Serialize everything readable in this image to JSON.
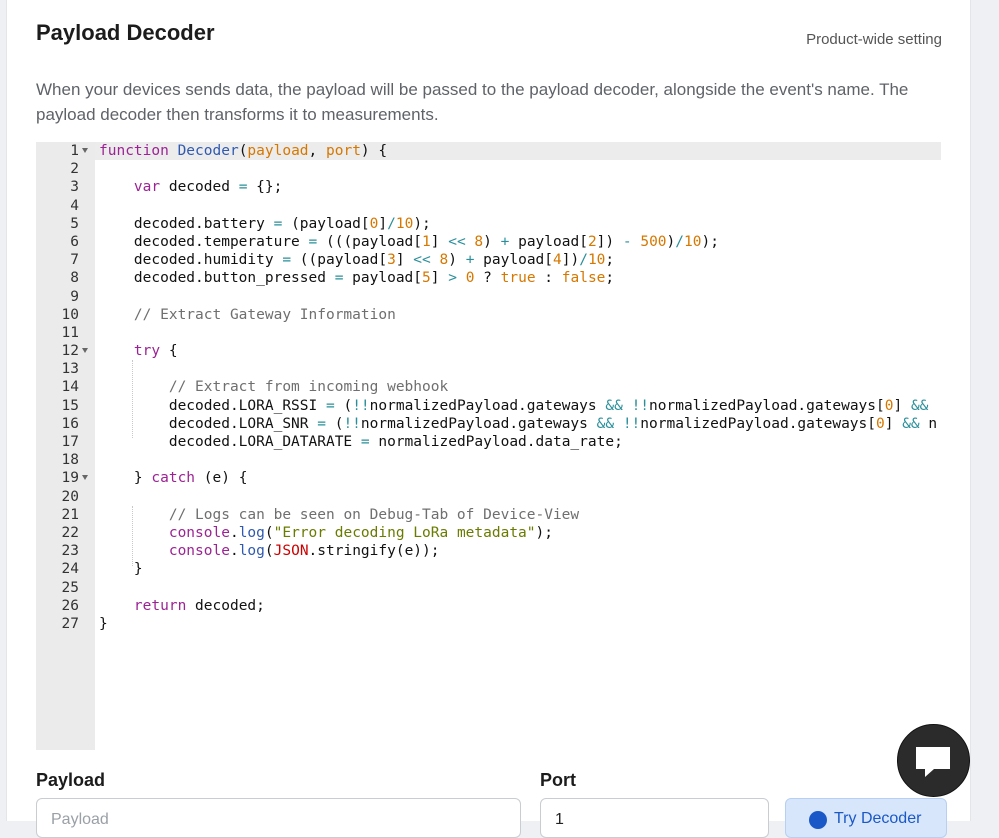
{
  "header": {
    "title": "Payload Decoder",
    "scope": "Product-wide setting"
  },
  "description": "When your devices sends data, the payload will be passed to the payload decoder, alongside the event's name. The payload decoder then transforms it to measurements.",
  "editor": {
    "lines": [
      {
        "n": "1",
        "fold": true,
        "tokens": [
          [
            "kw",
            "function "
          ],
          [
            "fn",
            "Decoder"
          ],
          [
            "pl",
            "("
          ],
          [
            "pa",
            "payload"
          ],
          [
            "pl",
            ", "
          ],
          [
            "pa",
            "port"
          ],
          [
            "pl",
            ") {"
          ]
        ]
      },
      {
        "n": "2",
        "tokens": []
      },
      {
        "n": "3",
        "tokens": [
          [
            "pl",
            "    "
          ],
          [
            "kw",
            "var "
          ],
          [
            "pl",
            "decoded "
          ],
          [
            "op",
            "="
          ],
          [
            "pl",
            " {};"
          ]
        ]
      },
      {
        "n": "4",
        "tokens": []
      },
      {
        "n": "5",
        "tokens": [
          [
            "pl",
            "    decoded.battery "
          ],
          [
            "op",
            "="
          ],
          [
            "pl",
            " (payload["
          ],
          [
            "nu",
            "0"
          ],
          [
            "pl",
            "]"
          ],
          [
            "op",
            "/"
          ],
          [
            "nu",
            "10"
          ],
          [
            "pl",
            ");"
          ]
        ]
      },
      {
        "n": "6",
        "tokens": [
          [
            "pl",
            "    decoded.temperature "
          ],
          [
            "op",
            "="
          ],
          [
            "pl",
            " (((payload["
          ],
          [
            "nu",
            "1"
          ],
          [
            "pl",
            "] "
          ],
          [
            "op",
            "<<"
          ],
          [
            "pl",
            " "
          ],
          [
            "nu",
            "8"
          ],
          [
            "pl",
            ") "
          ],
          [
            "op",
            "+"
          ],
          [
            "pl",
            " payload["
          ],
          [
            "nu",
            "2"
          ],
          [
            "pl",
            "]) "
          ],
          [
            "op",
            "-"
          ],
          [
            "pl",
            " "
          ],
          [
            "nu",
            "500"
          ],
          [
            "pl",
            ")"
          ],
          [
            "op",
            "/"
          ],
          [
            "nu",
            "10"
          ],
          [
            "pl",
            ");"
          ]
        ]
      },
      {
        "n": "7",
        "tokens": [
          [
            "pl",
            "    decoded.humidity "
          ],
          [
            "op",
            "="
          ],
          [
            "pl",
            " ((payload["
          ],
          [
            "nu",
            "3"
          ],
          [
            "pl",
            "] "
          ],
          [
            "op",
            "<<"
          ],
          [
            "pl",
            " "
          ],
          [
            "nu",
            "8"
          ],
          [
            "pl",
            ") "
          ],
          [
            "op",
            "+"
          ],
          [
            "pl",
            " payload["
          ],
          [
            "nu",
            "4"
          ],
          [
            "pl",
            "])"
          ],
          [
            "op",
            "/"
          ],
          [
            "nu",
            "10"
          ],
          [
            "pl",
            ";"
          ]
        ]
      },
      {
        "n": "8",
        "tokens": [
          [
            "pl",
            "    decoded.button_pressed "
          ],
          [
            "op",
            "="
          ],
          [
            "pl",
            " payload["
          ],
          [
            "nu",
            "5"
          ],
          [
            "pl",
            "] "
          ],
          [
            "op",
            ">"
          ],
          [
            "pl",
            " "
          ],
          [
            "nu",
            "0"
          ],
          [
            "pl",
            " ? "
          ],
          [
            "bo",
            "true"
          ],
          [
            "pl",
            " : "
          ],
          [
            "bo",
            "false"
          ],
          [
            "pl",
            ";"
          ]
        ]
      },
      {
        "n": "9",
        "tokens": []
      },
      {
        "n": "10",
        "tokens": [
          [
            "pl",
            "    "
          ],
          [
            "co",
            "// Extract Gateway Information"
          ]
        ]
      },
      {
        "n": "11",
        "tokens": []
      },
      {
        "n": "12",
        "fold": true,
        "tokens": [
          [
            "pl",
            "    "
          ],
          [
            "kw",
            "try"
          ],
          [
            "pl",
            " {"
          ]
        ]
      },
      {
        "n": "13",
        "tokens": []
      },
      {
        "n": "14",
        "tokens": [
          [
            "pl",
            "        "
          ],
          [
            "co",
            "// Extract from incoming webhook"
          ]
        ]
      },
      {
        "n": "15",
        "tokens": [
          [
            "pl",
            "        decoded.LORA_RSSI "
          ],
          [
            "op",
            "="
          ],
          [
            "pl",
            " ("
          ],
          [
            "op",
            "!!"
          ],
          [
            "pl",
            "normalizedPayload.gateways "
          ],
          [
            "op",
            "&&"
          ],
          [
            "pl",
            " "
          ],
          [
            "op",
            "!!"
          ],
          [
            "pl",
            "normalizedPayload.gateways["
          ],
          [
            "nu",
            "0"
          ],
          [
            "pl",
            "] "
          ],
          [
            "op",
            "&&"
          ]
        ]
      },
      {
        "n": "16",
        "tokens": [
          [
            "pl",
            "        decoded.LORA_SNR "
          ],
          [
            "op",
            "="
          ],
          [
            "pl",
            " ("
          ],
          [
            "op",
            "!!"
          ],
          [
            "pl",
            "normalizedPayload.gateways "
          ],
          [
            "op",
            "&&"
          ],
          [
            "pl",
            " "
          ],
          [
            "op",
            "!!"
          ],
          [
            "pl",
            "normalizedPayload.gateways["
          ],
          [
            "nu",
            "0"
          ],
          [
            "pl",
            "] "
          ],
          [
            "op",
            "&&"
          ],
          [
            "pl",
            " n"
          ]
        ]
      },
      {
        "n": "17",
        "tokens": [
          [
            "pl",
            "        decoded.LORA_DATARATE "
          ],
          [
            "op",
            "="
          ],
          [
            "pl",
            " normalizedPayload.data_rate;"
          ]
        ]
      },
      {
        "n": "18",
        "tokens": []
      },
      {
        "n": "19",
        "fold": true,
        "tokens": [
          [
            "pl",
            "    } "
          ],
          [
            "kw",
            "catch"
          ],
          [
            "pl",
            " (e) {"
          ]
        ]
      },
      {
        "n": "20",
        "tokens": []
      },
      {
        "n": "21",
        "tokens": [
          [
            "pl",
            "        "
          ],
          [
            "co",
            "// Logs can be seen on Debug-Tab of Device-View"
          ]
        ]
      },
      {
        "n": "22",
        "tokens": [
          [
            "pl",
            "        "
          ],
          [
            "kw",
            "console"
          ],
          [
            "pl",
            "."
          ],
          [
            "fn",
            "log"
          ],
          [
            "pl",
            "("
          ],
          [
            "st",
            "\"Error decoding LoRa metadata\""
          ],
          [
            "pl",
            ");"
          ]
        ]
      },
      {
        "n": "23",
        "tokens": [
          [
            "pl",
            "        "
          ],
          [
            "kw",
            "console"
          ],
          [
            "pl",
            "."
          ],
          [
            "fn",
            "log"
          ],
          [
            "pl",
            "("
          ],
          [
            "cl",
            "JSON"
          ],
          [
            "pl",
            ".stringify(e));"
          ]
        ]
      },
      {
        "n": "24",
        "tokens": [
          [
            "pl",
            "    }"
          ]
        ]
      },
      {
        "n": "25",
        "tokens": []
      },
      {
        "n": "26",
        "tokens": [
          [
            "pl",
            "    "
          ],
          [
            "kw",
            "return"
          ],
          [
            "pl",
            " decoded;"
          ]
        ]
      },
      {
        "n": "27",
        "tokens": [
          [
            "pl",
            "}"
          ]
        ]
      }
    ]
  },
  "form": {
    "payload_label": "Payload",
    "payload_placeholder": "Payload",
    "port_label": "Port",
    "port_value": "1",
    "try_button": "Try Decoder"
  },
  "icons": {
    "chat": "chat-bubble-icon",
    "play": "play-icon"
  }
}
